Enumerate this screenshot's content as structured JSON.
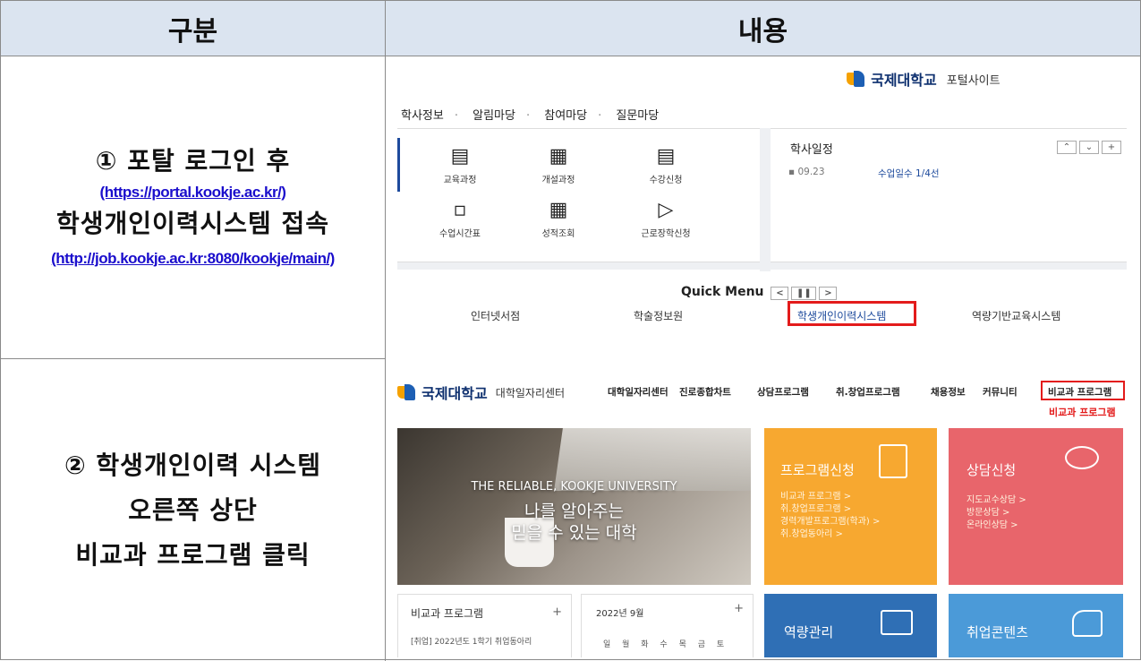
{
  "table": {
    "header_col1": "구분",
    "header_col2": "내용",
    "row1": {
      "line1": "① 포탈 로그인 후",
      "link1": "(https://portal.kookje.ac.kr/) ",
      "line2": "학생개인이력시스템 접속",
      "link2": "(http://job.kookje.ac.kr:8080/kookje/main/)"
    },
    "row2": {
      "line1": "② 학생개인이력 시스템",
      "line2": "오른쪽 상단",
      "line3": "비교과 프로그램 클릭"
    }
  },
  "portal": {
    "logo_text": "국제대학교",
    "site_name": "포털사이트",
    "nav": [
      "학사정보",
      "알림마당",
      "참여마당",
      "질문마당"
    ],
    "quick_items": [
      {
        "icon": "book-icon",
        "label": "교육과정"
      },
      {
        "icon": "building-icon",
        "label": "개설과정"
      },
      {
        "icon": "clipboard-icon",
        "label": "수강신청"
      },
      {
        "icon": "timetable-icon",
        "label": "수업시간표"
      },
      {
        "icon": "grades-icon",
        "label": "성적조회"
      },
      {
        "icon": "document-icon",
        "label": "근로장학신청"
      }
    ],
    "schedule_title": "학사일정",
    "schedule_date": "09.23",
    "schedule_text": "수업일수 1/4선",
    "quick_menu_title": "Quick Menu",
    "quick_links": [
      "인터넷서점",
      "학술정보원",
      "학생개인이력시스템",
      "역량기반교육시스템"
    ]
  },
  "career": {
    "logo_text": "국제대학교",
    "center_name": "대학일자리센터",
    "nav": [
      "대학일자리센터",
      "진로종합차트",
      "상담프로그램",
      "취.창업프로그램",
      "채용정보",
      "커뮤니티",
      "비교과 프로그램"
    ],
    "hover_label": "비교과 프로그램",
    "hero_line1": "THE RELIABLE, KOOKJE UNIVERSITY",
    "hero_line2": "나를 알아주는",
    "hero_line3": "믿을 수 있는 대학",
    "card1_title": "프로그램신청",
    "card1_links": [
      "비교과 프로그램 >",
      "취.창업프로그램 >",
      "경력개발프로그램(학과) >",
      "취.창업동아리 >"
    ],
    "card2_title": "상담신청",
    "card2_links": [
      "지도교수상담 >",
      "방문상담 >",
      "온라인상담 >"
    ],
    "box1_title": "비교과 프로그램",
    "box1_item": "[취업] 2022년도 1학기 취업동아리",
    "box2_title": "2022년 9월",
    "weekdays": "일 월 화 수 목 금 토",
    "card3_title": "역량관리",
    "card4_title": "취업콘텐츠",
    "colors": {
      "orange": "#f7a830",
      "pink": "#e8656b",
      "blue": "#2f6fb5",
      "lightblue": "#4b9ad8"
    }
  }
}
